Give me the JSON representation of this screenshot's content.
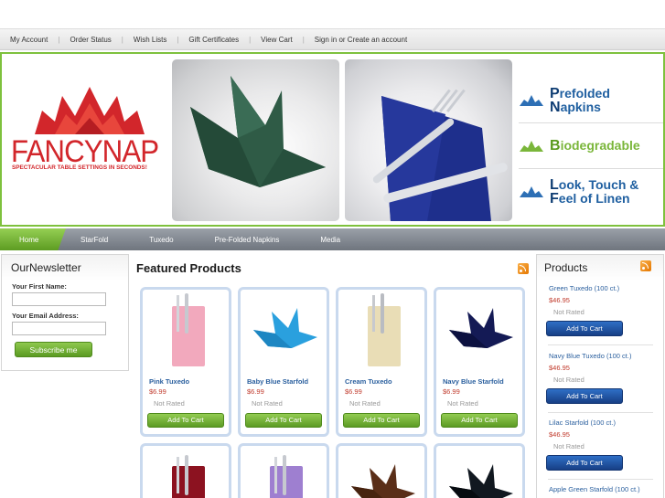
{
  "account_bar": {
    "links": [
      "My Account",
      "Order Status",
      "Wish Lists",
      "Gift Certificates",
      "View Cart"
    ],
    "sign_in": "Sign in or Create an account"
  },
  "banner": {
    "logo_text": "FANCYNAP",
    "tagline": "SPECTACULAR TABLE SETTINGS IN SECONDS!",
    "features": [
      {
        "line1_cap": "P",
        "line1": "refolded",
        "line2_cap": "N",
        "line2": "apkins",
        "color": "#1f5fa0"
      },
      {
        "line1_cap": "B",
        "line1": "iodegradable",
        "line2_cap": "",
        "line2": "",
        "color": "#7ab63a"
      },
      {
        "line1_cap": "L",
        "line1": "ook, Touch &",
        "line2_cap": "F",
        "line2": "eel of Linen",
        "color": "#1f5fa0"
      }
    ],
    "brand_red": "#d2262b",
    "border_green": "#7ec13d"
  },
  "nav": {
    "home": "Home",
    "items": [
      "StarFold",
      "Tuxedo",
      "Pre-Folded Napkins",
      "Media"
    ]
  },
  "newsletter": {
    "title": "OurNewsletter",
    "first_name_label": "Your First Name:",
    "email_label": "Your Email Address:",
    "subscribe": "Subscribe me"
  },
  "featured": {
    "title": "Featured Products",
    "products": [
      {
        "name": "Pink Tuxedo",
        "price": "$6.99",
        "rating": "Not Rated",
        "cart": "Add To Cart",
        "icon": "pink-tuxedo-napkin-icon"
      },
      {
        "name": "Baby Blue Starfold",
        "price": "$6.99",
        "rating": "Not Rated",
        "cart": "Add To Cart",
        "icon": "baby-blue-starfold-napkin-icon"
      },
      {
        "name": "Cream Tuxedo",
        "price": "$6.99",
        "rating": "Not Rated",
        "cart": "Add To Cart",
        "icon": "cream-tuxedo-napkin-icon"
      },
      {
        "name": "Navy Blue Starfold",
        "price": "$6.99",
        "rating": "Not Rated",
        "cart": "Add To Cart",
        "icon": "navy-starfold-napkin-icon"
      }
    ],
    "second_row_icons": [
      "burgundy-tuxedo-napkin-icon",
      "lilac-tuxedo-napkin-icon",
      "brown-starfold-napkin-icon",
      "black-starfold-napkin-icon"
    ]
  },
  "sidebar_products": {
    "title": "Products",
    "items": [
      {
        "name": "Green Tuxedo (100 ct.)",
        "price": "$46.95",
        "rating": "Not Rated",
        "cart": "Add To Cart"
      },
      {
        "name": "Navy Blue Tuxedo (100 ct.)",
        "price": "$46.95",
        "rating": "Not Rated",
        "cart": "Add To Cart"
      },
      {
        "name": "Lilac Starfold (100 ct.)",
        "price": "$46.95",
        "rating": "Not Rated",
        "cart": "Add To Cart"
      },
      {
        "name": "Apple Green Starfold (100 ct.)"
      }
    ]
  }
}
